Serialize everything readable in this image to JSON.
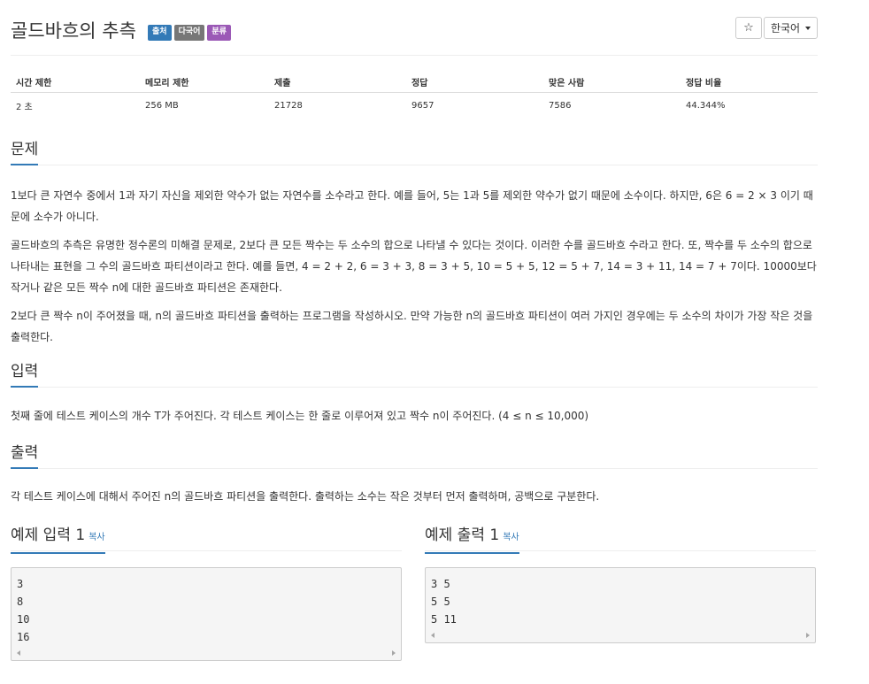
{
  "header": {
    "title": "골드바흐의 추측",
    "labels": [
      "출처",
      "다국어",
      "분류"
    ],
    "star_icon": "☆",
    "language": "한국어"
  },
  "info": {
    "headers": [
      "시간 제한",
      "메모리 제한",
      "제출",
      "정답",
      "맞은 사람",
      "정답 비율"
    ],
    "values": [
      "2 초",
      "256 MB",
      "21728",
      "9657",
      "7586",
      "44.344%"
    ]
  },
  "problem": {
    "heading": "문제",
    "p1": "1보다 큰 자연수 중에서  1과 자기 자신을 제외한 약수가 없는 자연수를 소수라고 한다. 예를 들어, 5는 1과 5를 제외한 약수가 없기 때문에 소수이다. 하지만, 6은 6 = 2 × 3 이기 때문에 소수가 아니다.",
    "p2": "골드바흐의 추측은 유명한 정수론의 미해결 문제로, 2보다 큰 모든 짝수는 두 소수의 합으로 나타낼 수 있다는 것이다. 이러한 수를 골드바흐 수라고 한다. 또, 짝수를 두 소수의 합으로 나타내는 표현을 그 수의 골드바흐 파티션이라고 한다. 예를 들면, 4 = 2 + 2, 6 = 3 + 3, 8 = 3 + 5, 10 = 5 + 5, 12 = 5 + 7, 14 = 3 + 11, 14 = 7 + 7이다. 10000보다 작거나 같은 모든 짝수 n에 대한 골드바흐 파티션은 존재한다.",
    "p3": "2보다 큰 짝수 n이 주어졌을 때, n의 골드바흐 파티션을 출력하는 프로그램을 작성하시오. 만약 가능한 n의 골드바흐 파티션이 여러 가지인 경우에는 두 소수의 차이가 가장 작은 것을 출력한다."
  },
  "input": {
    "heading": "입력",
    "text": "첫째 줄에 테스트 케이스의 개수 T가 주어진다. 각 테스트 케이스는 한 줄로 이루어져 있고 짝수 n이 주어진다. (4 ≤ n ≤ 10,000)"
  },
  "output": {
    "heading": "출력",
    "text": "각 테스트 케이스에 대해서 주어진 n의 골드바흐 파티션을 출력한다. 출력하는 소수는 작은 것부터 먼저 출력하며, 공백으로 구분한다."
  },
  "sample_input": {
    "heading": "예제 입력 1",
    "copy": "복사",
    "lines": [
      "3",
      "8",
      "10",
      "16"
    ]
  },
  "sample_output": {
    "heading": "예제 출력 1",
    "copy": "복사",
    "lines": [
      "3 5",
      "5 5",
      "5 11"
    ]
  },
  "colors": {
    "accent": "#337ab7",
    "label_gray": "#777777",
    "label_purple": "#9b59b6"
  }
}
